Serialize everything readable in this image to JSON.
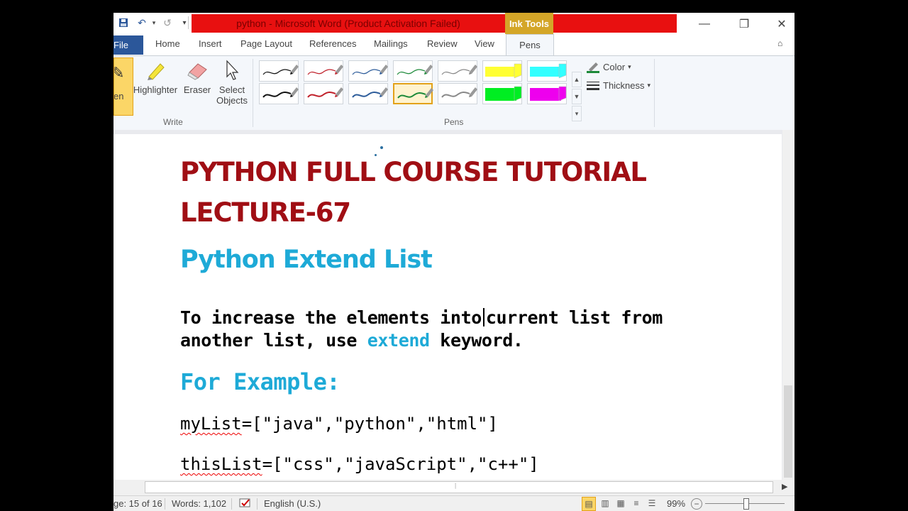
{
  "window": {
    "title": "python - Microsoft Word (Product Activation Failed)",
    "contextual_tab": "Ink Tools"
  },
  "qat": {
    "save_icon": "save-icon",
    "undo_icon": "undo-icon",
    "redo_icon": "redo-icon"
  },
  "tabs": {
    "file": "File",
    "home": "Home",
    "insert": "Insert",
    "page_layout": "Page Layout",
    "references": "References",
    "mailings": "Mailings",
    "review": "Review",
    "view": "View",
    "pens": "Pens"
  },
  "ribbon": {
    "pen_label": "en",
    "highlighter": "Highlighter",
    "eraser": "Eraser",
    "select_objects_line1": "Select",
    "select_objects_line2": "Objects",
    "write_group": "Write",
    "pens_group": "Pens",
    "color": "Color",
    "thickness": "Thickness"
  },
  "pens": {
    "row1": [
      "#111111",
      "#c0202a",
      "#2d5c9a",
      "#1d8a3a",
      "#888888",
      "#ffff33",
      "#33ffff"
    ],
    "row2": [
      "#111111",
      "#c0202a",
      "#2d5c9a",
      "#1d8a3a",
      "#888888",
      "#00ee22",
      "#ee00ee"
    ],
    "selected": "row2-4"
  },
  "document": {
    "title_line1": "PYTHON FULL COURSE TUTORIAL",
    "title_line2": "LECTURE-67",
    "heading": "Python Extend List",
    "para_line1_a": "To increase the elements into",
    "para_line1_b": "current list from",
    "para_line2_a": "another list, use ",
    "para_keyword": "extend",
    "para_line2_b": " keyword.",
    "example_heading": "For Example:",
    "code1_var": "myList",
    "code1_rest": "=[\"java\",\"python\",\"html\"]",
    "code2_var": "thisList",
    "code2_rest": "=[\"css\",\"javaScript\",\"c++\"]"
  },
  "status": {
    "page": "ge: 15 of 16",
    "words": "Words: 1,102",
    "language": "English (U.S.)",
    "zoom": "99%"
  }
}
